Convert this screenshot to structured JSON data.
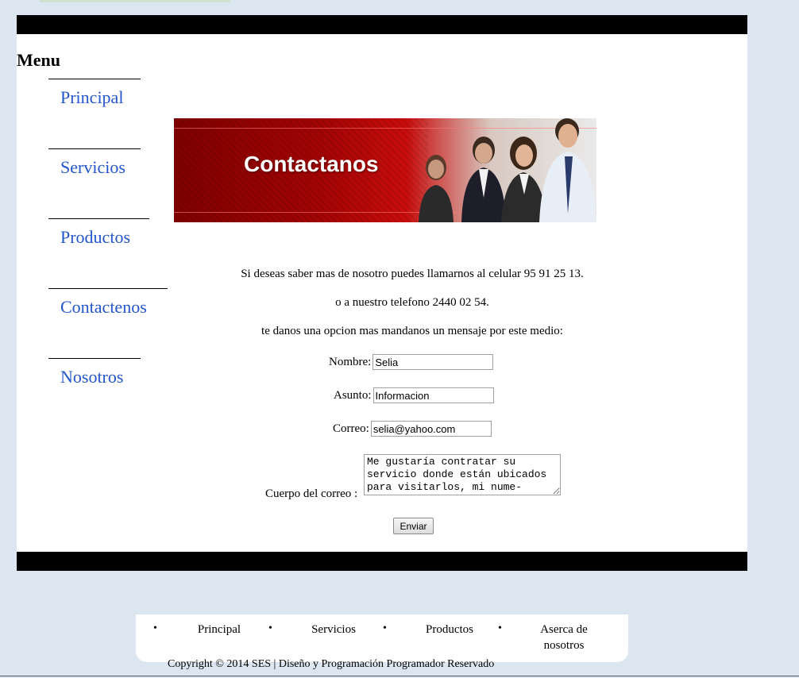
{
  "menu": {
    "title": "Menu",
    "items": [
      {
        "label": "Principal"
      },
      {
        "label": "Servicios"
      },
      {
        "label": "Productos"
      },
      {
        "label": "Contactenos"
      },
      {
        "label": "Nosotros"
      }
    ]
  },
  "banner": {
    "title": "Contactanos"
  },
  "content": {
    "line1": "Si deseas saber mas de nosotro puedes llamarnos al celular 95 91 25 13.",
    "line2": "o a nuestro telefono 2440 02 54.",
    "line3": "te danos una opcion mas mandanos un mensaje por este medio:"
  },
  "form": {
    "nombre_label": "Nombre:",
    "nombre_value": "Selia",
    "asunto_label": "Asunto:",
    "asunto_value": "Informacion",
    "correo_label": "Correo:",
    "correo_value": "selia@yahoo.com",
    "cuerpo_label": "Cuerpo del correo :",
    "cuerpo_value": "Me gustaría contratar su servicio donde están ubicados para visitarlos, mi nume-",
    "submit_label": "Enviar"
  },
  "footer": {
    "nav": [
      {
        "label": "Principal"
      },
      {
        "label": "Servicios"
      },
      {
        "label": "Productos"
      },
      {
        "label": "Aserca de nosotros"
      }
    ],
    "bullet": "•",
    "copyright": "Copyright © 2014 SES | Diseño y Programación Programador Reservado"
  }
}
